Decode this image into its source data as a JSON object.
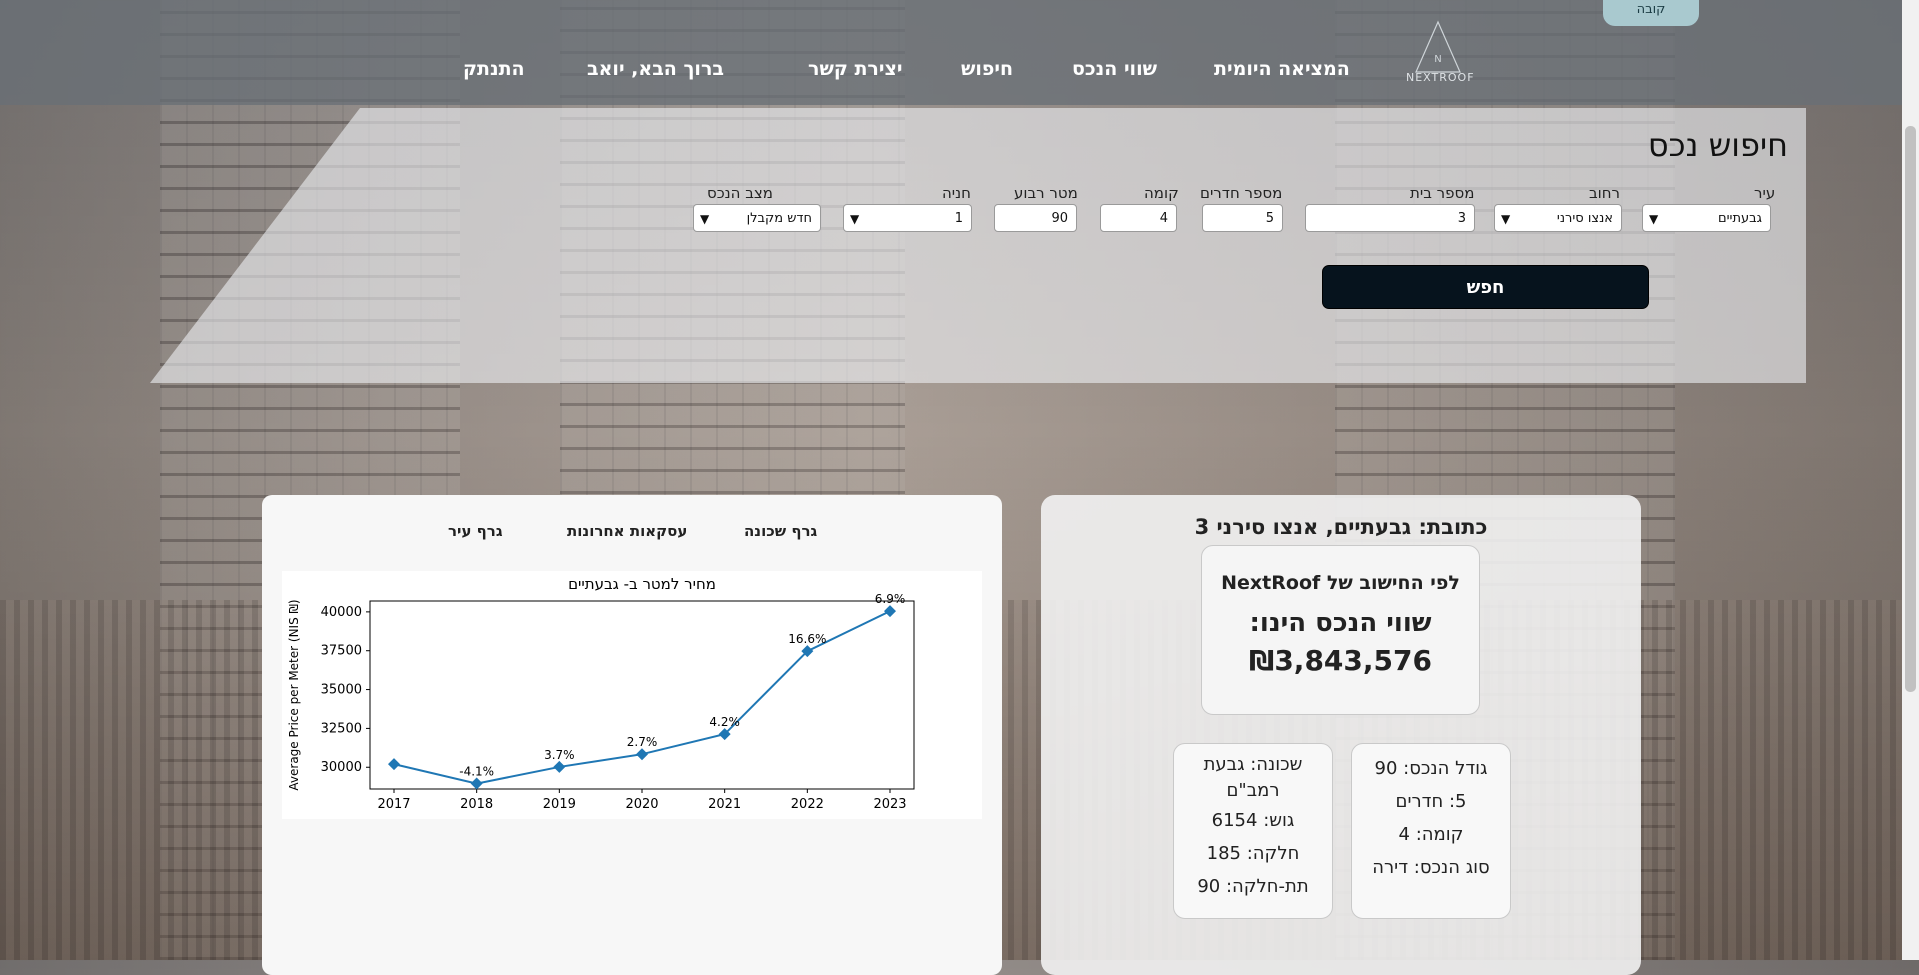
{
  "header": {
    "nav": [
      "המציאה היומית",
      "שווי הנכס",
      "חיפוש",
      "יצירת קשר",
      "ברוך הבא, יואב",
      "התנתק"
    ],
    "logo_text": "NEXTROOF",
    "top_button": "קובה"
  },
  "search": {
    "title": "חיפוש נכס",
    "button_label": "חפש",
    "fields": {
      "city": {
        "label": "עיר",
        "value": "גבעתיים"
      },
      "street": {
        "label": "רחוב",
        "value": "אנצו סירני"
      },
      "house_number": {
        "label": "מספר בית",
        "value": "3"
      },
      "rooms": {
        "label": "מספר חדרים",
        "value": "5"
      },
      "floor": {
        "label": "קומה",
        "value": "4"
      },
      "sqm": {
        "label": "מטר רבוע",
        "value": "90"
      },
      "parking": {
        "label": "חניה",
        "value": "1"
      },
      "condition": {
        "label": "מצב הנכס",
        "value": "חדש מקבלן"
      }
    }
  },
  "chart_panel": {
    "tabs": [
      "גרף שכונה",
      "עסקאות אחרונות",
      "גרף עיר"
    ]
  },
  "chart_data": {
    "type": "line",
    "title": "מחיר למטר ב- גבעתיים",
    "xlabel": "",
    "ylabel": "Average Price per Meter (NIS ₪)",
    "x": [
      "2017",
      "2018",
      "2019",
      "2020",
      "2021",
      "2022",
      "2023"
    ],
    "values": [
      30200,
      28950,
      30020,
      30840,
      32130,
      37470,
      40050
    ],
    "annotations": [
      "",
      "-4.1%",
      "3.7%",
      "2.7%",
      "4.2%",
      "16.6%",
      "6.9%"
    ],
    "yticks": [
      "30000",
      "32500",
      "35000",
      "37500",
      "40000"
    ],
    "ylim": [
      28600,
      40700
    ],
    "color": "#1f77b4",
    "marker": "diamond",
    "grid": false
  },
  "property": {
    "address": "כתובת: גבעתיים, אנצו סירני 3",
    "calc_label": "לפי החישוב של NextRoof",
    "value_label": "שווי הנכס הינו:",
    "value": "₪3,843,576",
    "details_left": [
      "גודל הנכס: 90",
      "5: חדרים",
      "קומה: 4",
      "סוג הנכס: דירה"
    ],
    "details_right": [
      "שכונה: גבעת רמב\"ם",
      "גוש: 6154",
      "חלקה: 185",
      "תת-חלקה: 90"
    ]
  }
}
